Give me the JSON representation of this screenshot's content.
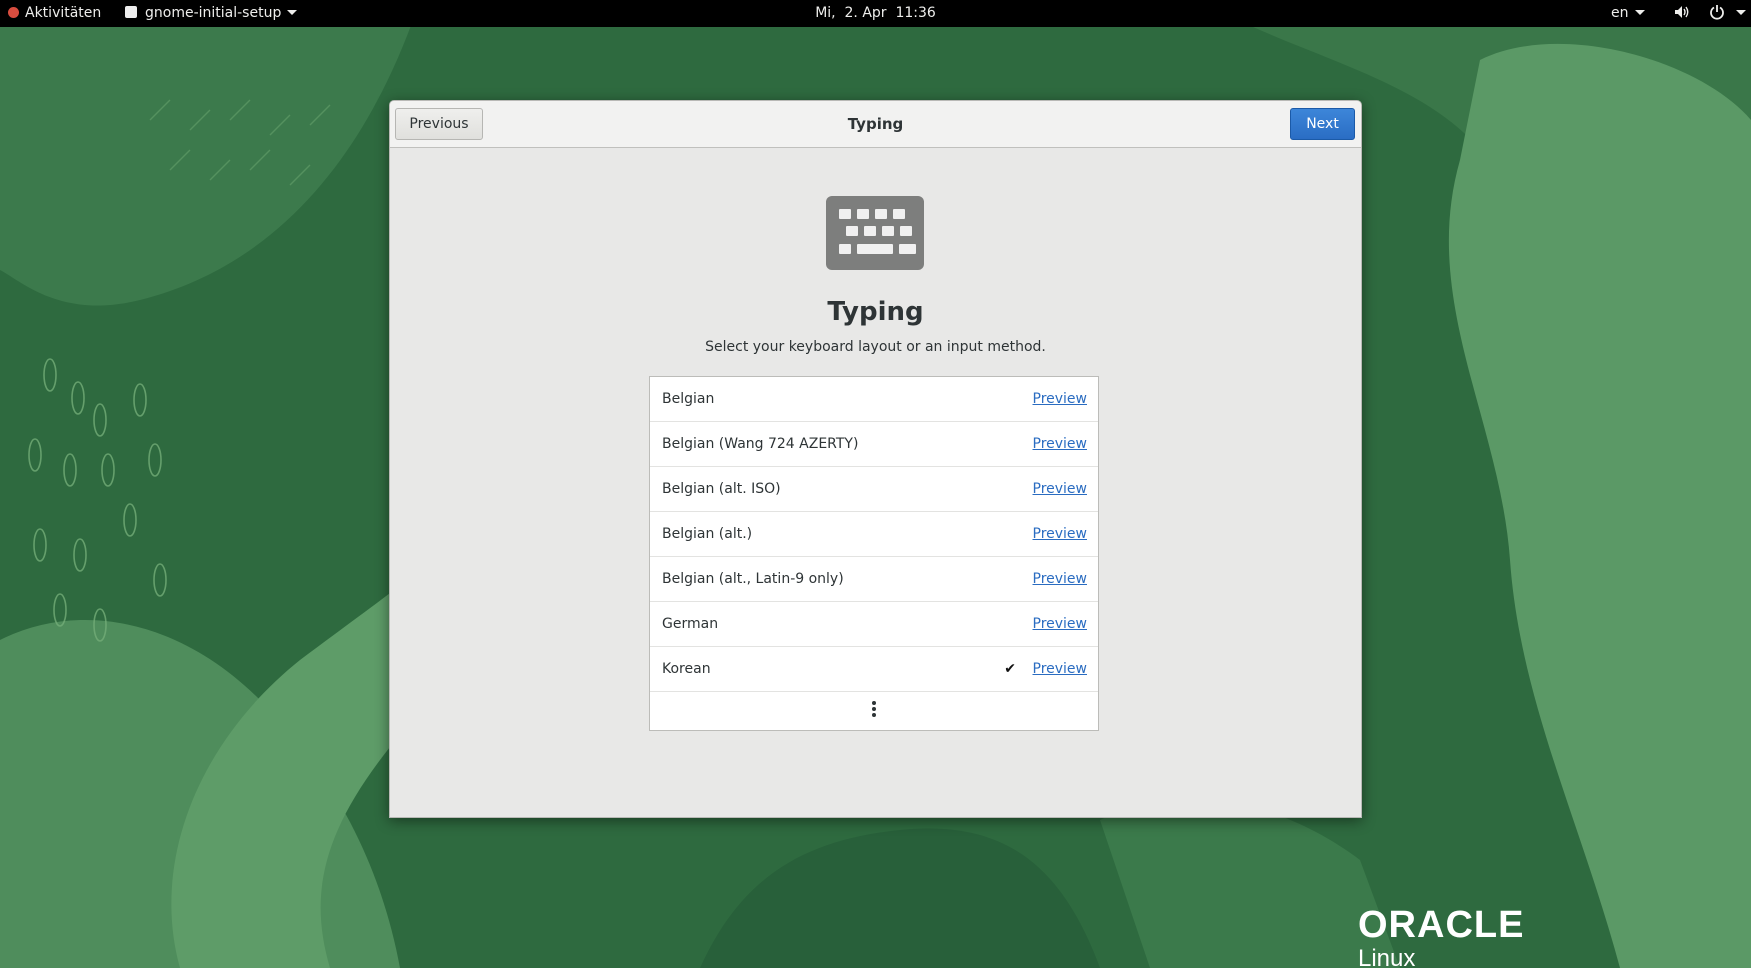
{
  "topbar": {
    "activities": "Aktivitäten",
    "app_name": "gnome-initial-setup",
    "clock": "Mi,  2. Apr  11:36",
    "input_language": "en"
  },
  "window": {
    "title": "Typing",
    "previous_label": "Previous",
    "next_label": "Next"
  },
  "page": {
    "icon": "keyboard-icon",
    "heading": "Typing",
    "description": "Select your keyboard layout or an input method."
  },
  "layouts": [
    {
      "name": "Belgian",
      "preview": "Preview",
      "selected": false
    },
    {
      "name": "Belgian (Wang 724 AZERTY)",
      "preview": "Preview",
      "selected": false
    },
    {
      "name": "Belgian (alt. ISO)",
      "preview": "Preview",
      "selected": false
    },
    {
      "name": "Belgian (alt.)",
      "preview": "Preview",
      "selected": false
    },
    {
      "name": "Belgian (alt., Latin-9 only)",
      "preview": "Preview",
      "selected": false
    },
    {
      "name": "German",
      "preview": "Preview",
      "selected": false
    },
    {
      "name": "Korean",
      "preview": "Preview",
      "selected": true
    }
  ],
  "more_icon": "view-more-icon",
  "branding": {
    "logo": "ORACLE",
    "product": "Linux"
  },
  "colors": {
    "accent": "#2a6dc4",
    "link": "#2a6cc1",
    "topbar": "#000000",
    "wallpaper": "#2f6b40"
  }
}
